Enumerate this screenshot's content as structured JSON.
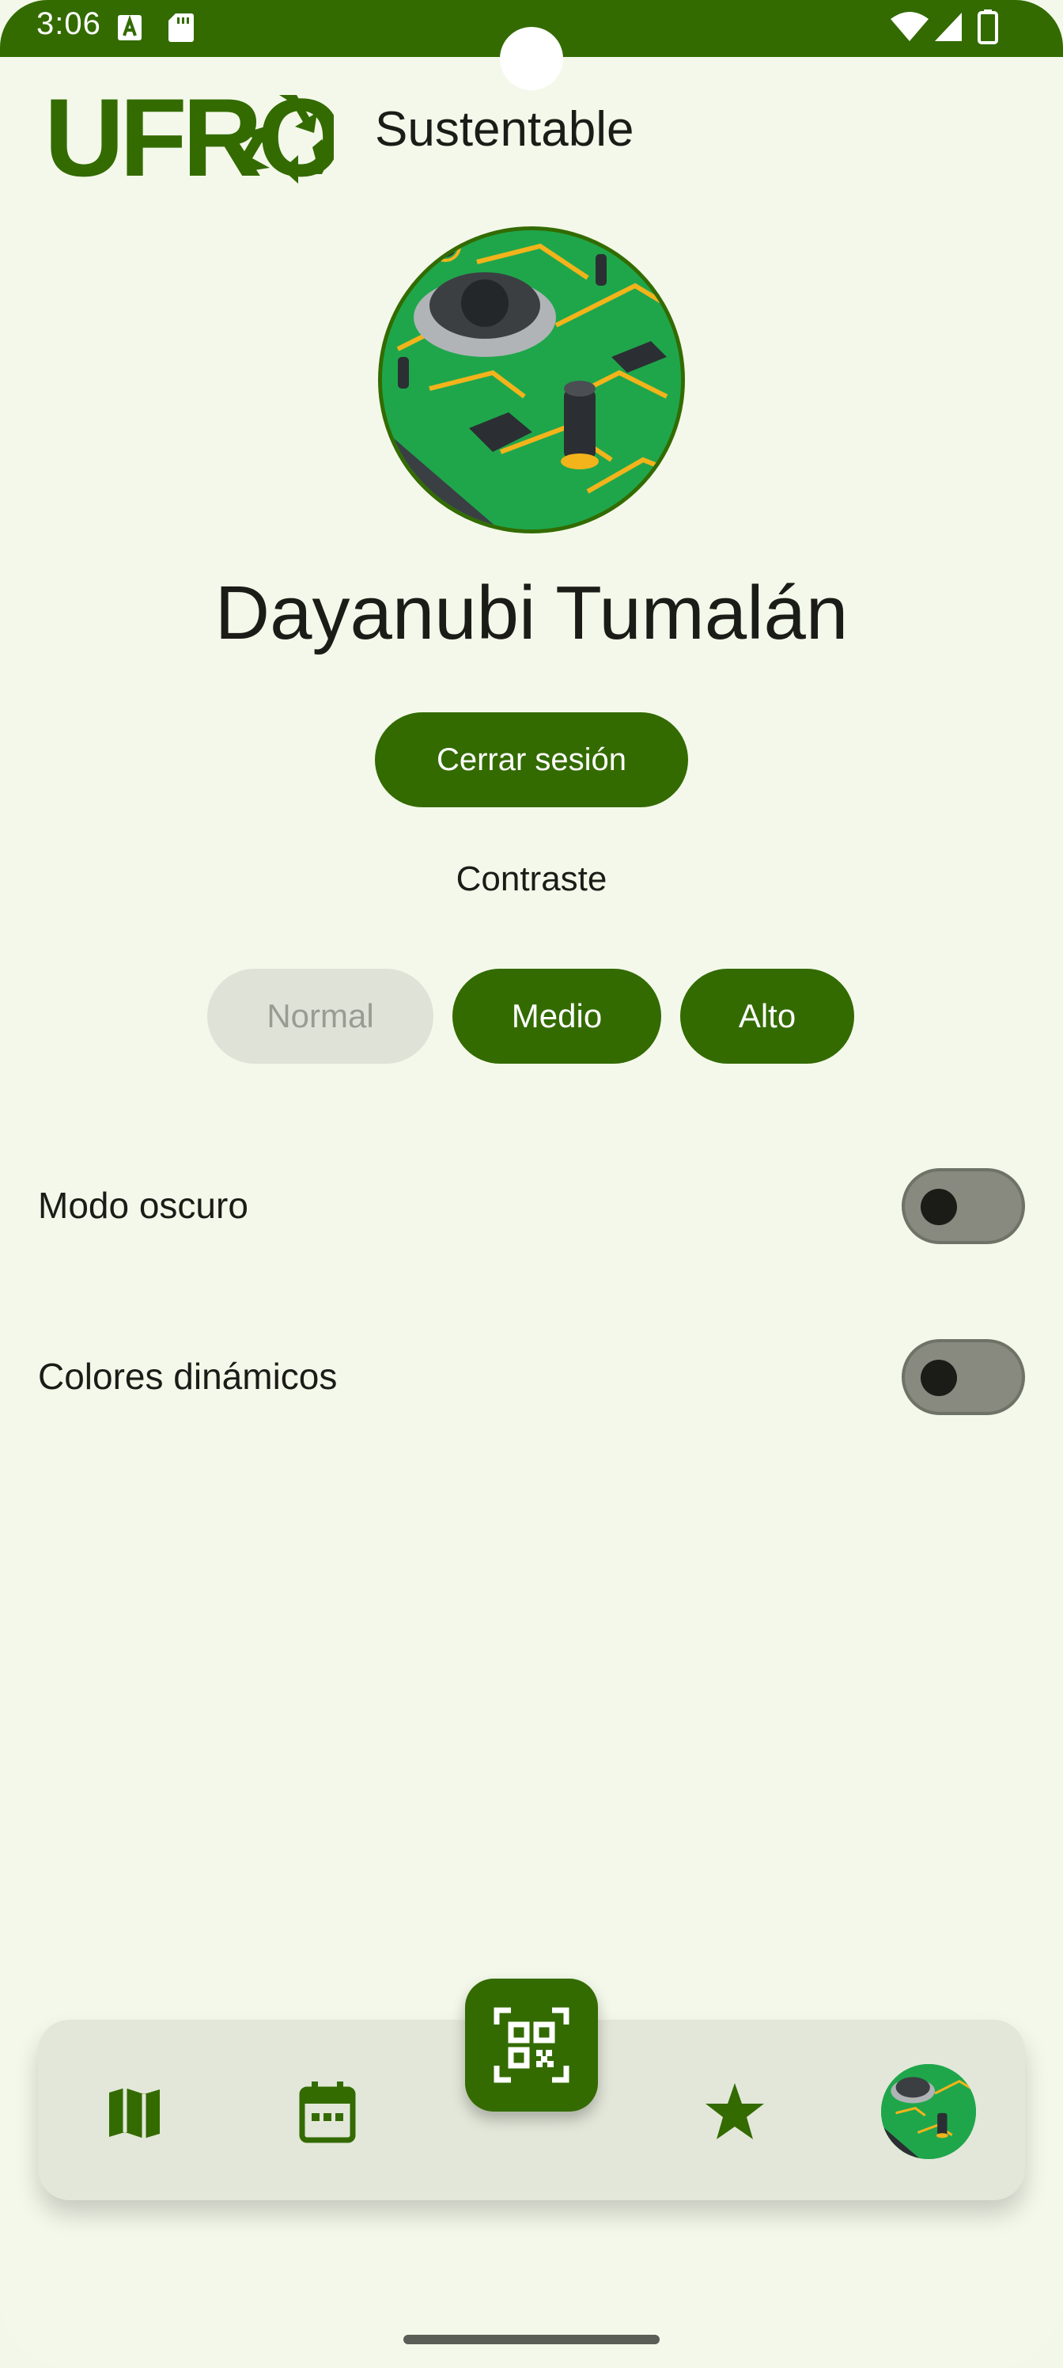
{
  "status_bar": {
    "time": "3:06",
    "icons": [
      "a-notification-icon",
      "sd-card-icon",
      "wifi-icon",
      "signal-icon",
      "battery-icon"
    ]
  },
  "header": {
    "logo_text": "UFRO",
    "title": "Sustentable"
  },
  "profile": {
    "name": "Dayanubi Tumalán",
    "logout_label": "Cerrar sesión"
  },
  "contrast": {
    "label": "Contraste",
    "options": [
      "Normal",
      "Medio",
      "Alto"
    ],
    "selected": "Normal"
  },
  "settings": [
    {
      "label": "Modo oscuro",
      "enabled": false
    },
    {
      "label": "Colores dinámicos",
      "enabled": false
    }
  ],
  "bottom_nav": {
    "items": [
      "map-icon",
      "calendar-icon",
      "qr-code-icon",
      "star-icon",
      "profile-avatar"
    ]
  },
  "colors": {
    "primary": "#336b00",
    "background": "#f4f8ea",
    "nav_surface": "#e3e7d9",
    "disabled_chip": "#dfe2d7"
  }
}
